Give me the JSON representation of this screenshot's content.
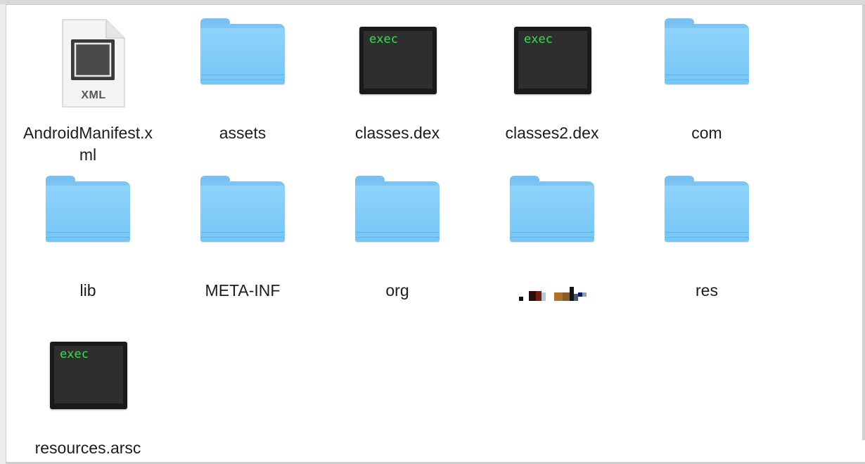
{
  "window": {
    "background": "#ffffff"
  },
  "items": [
    {
      "name": "AndroidManifest.xml",
      "display": "AndroidManifest.x ml",
      "kind": "xml-file",
      "icon": "xml-document-icon",
      "badge": "XML"
    },
    {
      "name": "assets",
      "kind": "folder",
      "icon": "folder-icon"
    },
    {
      "name": "classes.dex",
      "kind": "exec",
      "icon": "exec-terminal-icon",
      "badge": "exec"
    },
    {
      "name": "classes2.dex",
      "kind": "exec",
      "icon": "exec-terminal-icon",
      "badge": "exec"
    },
    {
      "name": "com",
      "kind": "folder",
      "icon": "folder-icon"
    },
    {
      "name": "lib",
      "kind": "folder",
      "icon": "folder-icon"
    },
    {
      "name": "META-INF",
      "kind": "folder",
      "icon": "folder-icon"
    },
    {
      "name": "org",
      "kind": "folder",
      "icon": "folder-icon"
    },
    {
      "name": "",
      "kind": "folder",
      "icon": "folder-icon",
      "label_redacted": true
    },
    {
      "name": "res",
      "kind": "folder",
      "icon": "folder-icon"
    },
    {
      "name": "resources.arsc",
      "kind": "exec",
      "icon": "exec-terminal-icon",
      "badge": "exec"
    }
  ],
  "colors": {
    "folder": "#7dc4f2",
    "exec_text": "#35e04a",
    "exec_body": "#1a1a1a"
  }
}
